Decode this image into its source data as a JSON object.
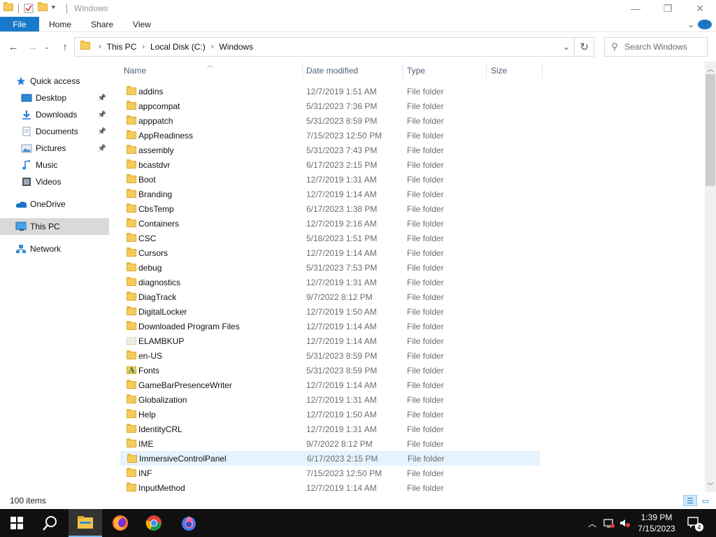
{
  "window": {
    "title": "Windows"
  },
  "ribbon": {
    "tabs": [
      "File",
      "Home",
      "Share",
      "View"
    ]
  },
  "address": {
    "crumbs": [
      "This PC",
      "Local Disk (C:)",
      "Windows"
    ]
  },
  "search": {
    "placeholder": "Search Windows"
  },
  "sidebar": {
    "items": [
      {
        "label": "Quick access",
        "icon": "star-icon"
      },
      {
        "label": "Desktop",
        "icon": "desktop-icon",
        "pinned": true
      },
      {
        "label": "Downloads",
        "icon": "downloads-icon",
        "pinned": true
      },
      {
        "label": "Documents",
        "icon": "documents-icon",
        "pinned": true
      },
      {
        "label": "Pictures",
        "icon": "pictures-icon",
        "pinned": true
      },
      {
        "label": "Music",
        "icon": "music-icon"
      },
      {
        "label": "Videos",
        "icon": "videos-icon"
      },
      {
        "label": "OneDrive",
        "icon": "cloud-icon"
      },
      {
        "label": "This PC",
        "icon": "computer-icon",
        "selected": true
      },
      {
        "label": "Network",
        "icon": "network-icon"
      }
    ]
  },
  "columns": {
    "name": "Name",
    "date": "Date modified",
    "type": "Type",
    "size": "Size"
  },
  "files": [
    {
      "name": "addins",
      "date": "12/7/2019 1:51 AM",
      "type": "File folder"
    },
    {
      "name": "appcompat",
      "date": "5/31/2023 7:36 PM",
      "type": "File folder"
    },
    {
      "name": "apppatch",
      "date": "5/31/2023 8:59 PM",
      "type": "File folder"
    },
    {
      "name": "AppReadiness",
      "date": "7/15/2023 12:50 PM",
      "type": "File folder"
    },
    {
      "name": "assembly",
      "date": "5/31/2023 7:43 PM",
      "type": "File folder"
    },
    {
      "name": "bcastdvr",
      "date": "6/17/2023 2:15 PM",
      "type": "File folder"
    },
    {
      "name": "Boot",
      "date": "12/7/2019 1:31 AM",
      "type": "File folder"
    },
    {
      "name": "Branding",
      "date": "12/7/2019 1:14 AM",
      "type": "File folder"
    },
    {
      "name": "CbsTemp",
      "date": "6/17/2023 1:38 PM",
      "type": "File folder"
    },
    {
      "name": "Containers",
      "date": "12/7/2019 2:16 AM",
      "type": "File folder"
    },
    {
      "name": "CSC",
      "date": "5/18/2023 1:51 PM",
      "type": "File folder"
    },
    {
      "name": "Cursors",
      "date": "12/7/2019 1:14 AM",
      "type": "File folder"
    },
    {
      "name": "debug",
      "date": "5/31/2023 7:53 PM",
      "type": "File folder"
    },
    {
      "name": "diagnostics",
      "date": "12/7/2019 1:31 AM",
      "type": "File folder"
    },
    {
      "name": "DiagTrack",
      "date": "9/7/2022 8:12 PM",
      "type": "File folder"
    },
    {
      "name": "DigitalLocker",
      "date": "12/7/2019 1:50 AM",
      "type": "File folder"
    },
    {
      "name": "Downloaded Program Files",
      "date": "12/7/2019 1:14 AM",
      "type": "File folder"
    },
    {
      "name": "ELAMBKUP",
      "date": "12/7/2019 1:14 AM",
      "type": "File folder",
      "icon": "plain"
    },
    {
      "name": "en-US",
      "date": "5/31/2023 8:59 PM",
      "type": "File folder"
    },
    {
      "name": "Fonts",
      "date": "5/31/2023 8:59 PM",
      "type": "File folder",
      "icon": "fonts"
    },
    {
      "name": "GameBarPresenceWriter",
      "date": "12/7/2019 1:14 AM",
      "type": "File folder"
    },
    {
      "name": "Globalization",
      "date": "12/7/2019 1:31 AM",
      "type": "File folder"
    },
    {
      "name": "Help",
      "date": "12/7/2019 1:50 AM",
      "type": "File folder"
    },
    {
      "name": "IdentityCRL",
      "date": "12/7/2019 1:31 AM",
      "type": "File folder"
    },
    {
      "name": "IME",
      "date": "9/7/2022 8:12 PM",
      "type": "File folder"
    },
    {
      "name": "ImmersiveControlPanel",
      "date": "6/17/2023 2:15 PM",
      "type": "File folder",
      "hover": true
    },
    {
      "name": "INF",
      "date": "7/15/2023 12:50 PM",
      "type": "File folder"
    },
    {
      "name": "InputMethod",
      "date": "12/7/2019 1:14 AM",
      "type": "File folder"
    }
  ],
  "status": {
    "count": "100 items"
  },
  "taskbar": {
    "time": "1:39 PM",
    "date": "7/15/2023",
    "notifications": "4",
    "apps": [
      "start-icon",
      "search-icon",
      "file-explorer-icon",
      "firefox-icon",
      "chrome-icon",
      "firefox-dev-icon"
    ]
  },
  "colors": {
    "accent": "#1979ca",
    "folder": "#f5cc5c",
    "hover_row": "#e5f3ff",
    "selected_nav": "#d9d9d9"
  }
}
